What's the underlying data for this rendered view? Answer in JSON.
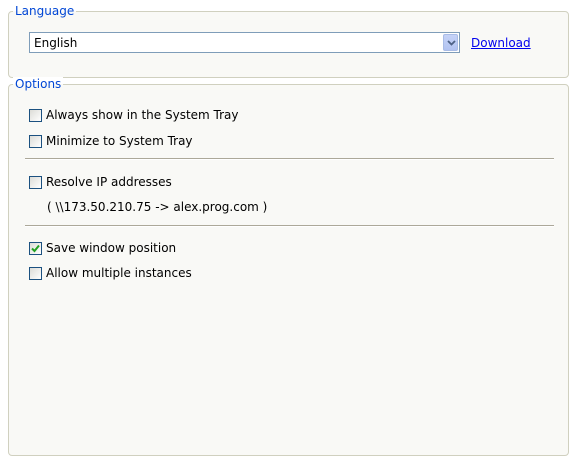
{
  "language_group": {
    "legend": "Language",
    "select_value": "English",
    "download_label": "Download"
  },
  "options_group": {
    "legend": "Options",
    "always_show_tray": {
      "label": "Always show in the System Tray",
      "checked": false
    },
    "minimize_to_tray": {
      "label": "Minimize to System Tray",
      "checked": false
    },
    "resolve_ip": {
      "label": "Resolve IP addresses",
      "checked": false
    },
    "resolve_ip_hint": "( \\\\173.50.210.75 -> alex.prog.com )",
    "save_window_position": {
      "label": "Save window position",
      "checked": true
    },
    "allow_multiple_instances": {
      "label": "Allow multiple instances",
      "checked": false
    }
  },
  "colors": {
    "legend_text": "#0046d5",
    "link": "#0000ee",
    "group_border": "#d0d0bf",
    "checkmark": "#21a121"
  }
}
